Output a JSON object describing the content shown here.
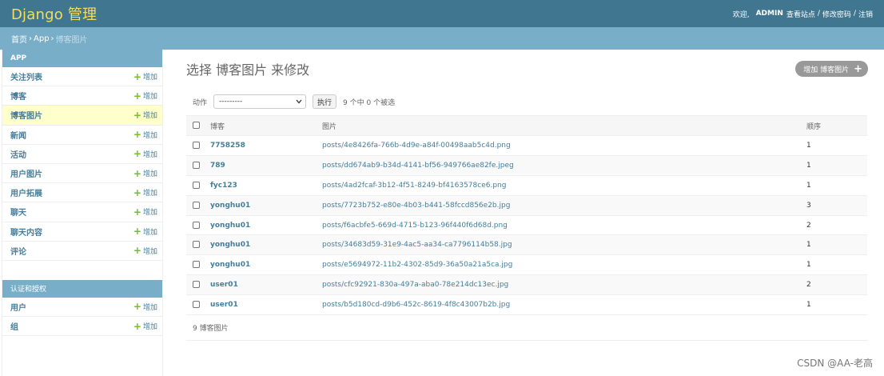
{
  "header": {
    "brand": "Django 管理",
    "welcome": "欢迎,",
    "username": "ADMIN",
    "view_site": "查看站点",
    "change_password": "修改密码",
    "logout": "注销",
    "separator": "/"
  },
  "breadcrumbs": {
    "home": "首页",
    "app": "App",
    "current": "博客图片",
    "separator": "›"
  },
  "sidebar": {
    "app_caption": "APP",
    "add_label": "增加",
    "app_items": [
      {
        "label": "关注列表"
      },
      {
        "label": "博客"
      },
      {
        "label": "博客图片"
      },
      {
        "label": "新闻"
      },
      {
        "label": "活动"
      },
      {
        "label": "用户图片"
      },
      {
        "label": "用户拓展"
      },
      {
        "label": "聊天"
      },
      {
        "label": "聊天内容"
      },
      {
        "label": "评论"
      }
    ],
    "auth_caption": "认证和授权",
    "auth_items": [
      {
        "label": "用户"
      },
      {
        "label": "组"
      }
    ]
  },
  "main": {
    "title": "选择 博客图片 来修改",
    "add_button": "增加 博客图片",
    "action_label": "动作",
    "action_select_value": "---------",
    "go_button": "执行",
    "selection_counter": "9 个中 0 个被选",
    "columns": [
      "博客",
      "图片",
      "顺序"
    ],
    "rows": [
      {
        "blog": "7758258",
        "image": "posts/4e8426fa-766b-4d9e-a84f-00498aab5c4d.png",
        "order": "1"
      },
      {
        "blog": "789",
        "image": "posts/dd674ab9-b34d-4141-bf56-949766ae82fe.jpeg",
        "order": "1"
      },
      {
        "blog": "fyc123",
        "image": "posts/4ad2fcaf-3b12-4f51-8249-bf4163578ce6.png",
        "order": "1"
      },
      {
        "blog": "yonghu01",
        "image": "posts/7723b752-e80e-4b03-b441-58fccd856e2b.jpg",
        "order": "3"
      },
      {
        "blog": "yonghu01",
        "image": "posts/f6acbfe5-669d-4715-b123-96f440f6d68d.png",
        "order": "2"
      },
      {
        "blog": "yonghu01",
        "image": "posts/34683d59-31e9-4ac5-aa34-ca7796114b58.jpg",
        "order": "1"
      },
      {
        "blog": "yonghu01",
        "image": "posts/e5694972-11b2-4302-85d9-36a50a21a5ca.jpg",
        "order": "1"
      },
      {
        "blog": "user01",
        "image": "posts/cfc92921-830a-497a-aba0-78e214dc13ec.jpg",
        "order": "2"
      },
      {
        "blog": "user01",
        "image": "posts/b5d180cd-d9b6-452c-8619-4f8c43007b2b.jpg",
        "order": "1"
      }
    ],
    "paginator": "9 博客图片"
  },
  "watermark": "CSDN @AA-老高",
  "colors": {
    "header_bg": "#417690",
    "brand": "#f5dd5d",
    "breadcrumb_bg": "#79aec8",
    "link": "#447e9b",
    "add_plus": "#70bf2b",
    "active_row": "#ffffcc"
  }
}
